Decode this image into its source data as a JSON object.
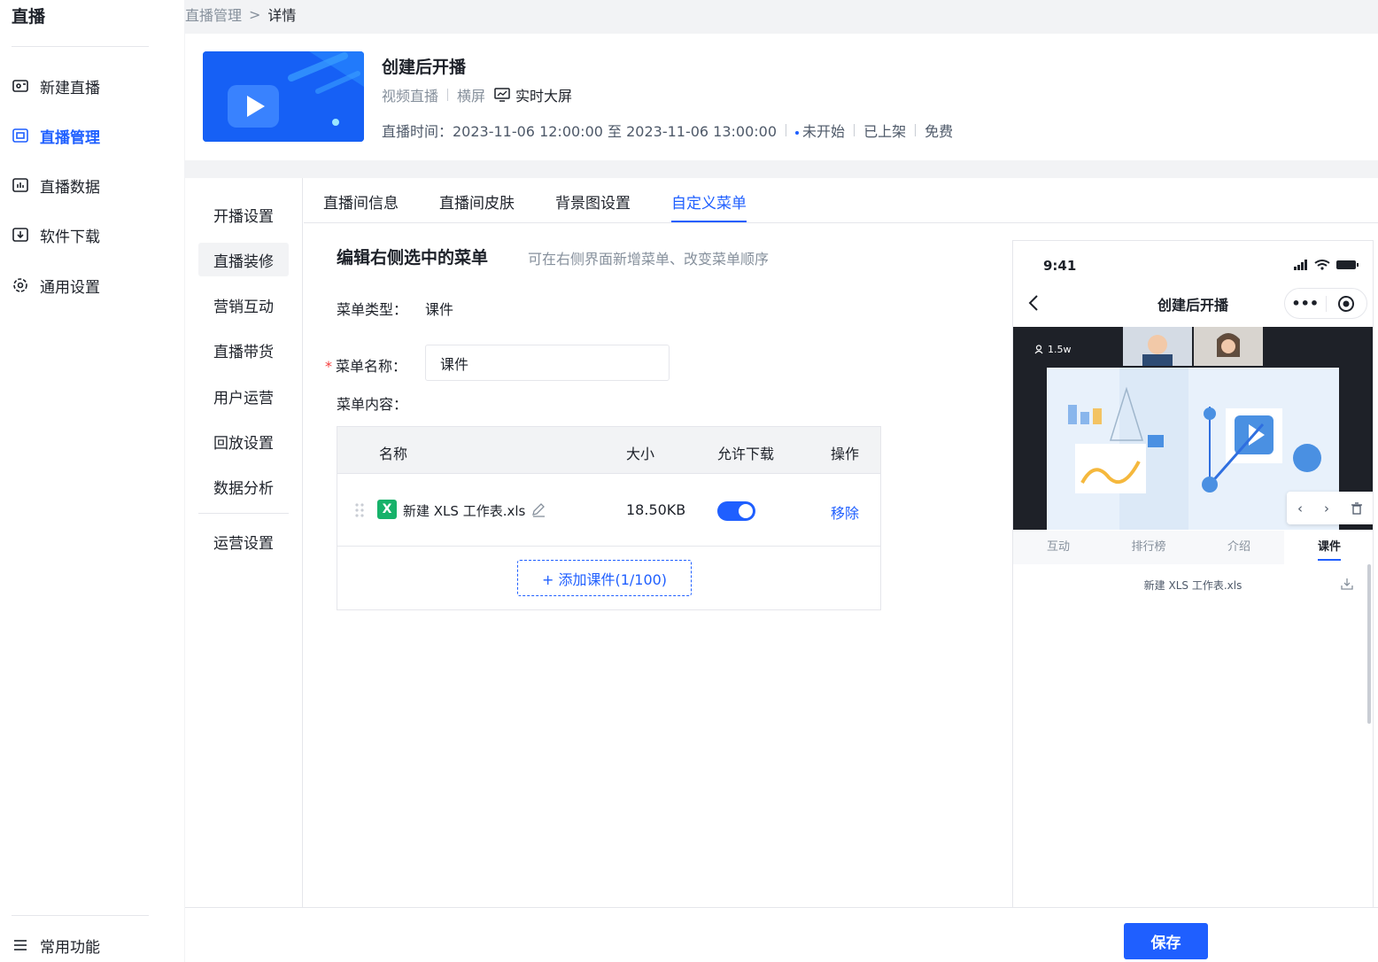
{
  "sidebar": {
    "title": "直播",
    "items": [
      {
        "label": "新建直播",
        "icon": "video-add-icon"
      },
      {
        "label": "直播管理",
        "icon": "live-manage-icon",
        "active": true
      },
      {
        "label": "直播数据",
        "icon": "data-chart-icon"
      },
      {
        "label": "软件下载",
        "icon": "download-icon"
      },
      {
        "label": "通用设置",
        "icon": "gear-icon"
      }
    ],
    "footer_label": "常用功能"
  },
  "breadcrumb": {
    "parent": "直播管理",
    "separator": ">",
    "current": "详情"
  },
  "live": {
    "title": "创建后开播",
    "type": "视频直播",
    "orientation": "横屏",
    "bigscreen": "实时大屏",
    "time_label": "直播时间：2023-11-06 12:00:00 至 2023-11-06 13:00:00",
    "status": "未开始",
    "shelf": "已上架",
    "price": "免费"
  },
  "subnav": [
    "开播设置",
    "直播装修",
    "营销互动",
    "直播带货",
    "用户运营",
    "回放设置",
    "数据分析",
    "运营设置"
  ],
  "tabs": [
    "直播间信息",
    "直播间皮肤",
    "背景图设置",
    "自定义菜单"
  ],
  "active_tab": "自定义菜单",
  "editor": {
    "title": "编辑右侧选中的菜单",
    "hint": "可在右侧界面新增菜单、改变菜单顺序",
    "type_label": "菜单类型：",
    "type_value": "课件",
    "name_label": "菜单名称：",
    "name_value": "课件",
    "content_label": "菜单内容："
  },
  "table": {
    "headers": {
      "name": "名称",
      "size": "大小",
      "download": "允许下载",
      "action": "操作"
    },
    "rows": [
      {
        "name": "新建 XLS 工作表.xls",
        "size": "18.50KB",
        "allow_download": true,
        "action": "移除"
      }
    ],
    "add_button": "+ 添加课件(1/100)"
  },
  "phone": {
    "time": "9:41",
    "title": "创建后开播",
    "more": "•••",
    "viewers": "1.5w",
    "tabs": [
      "互动",
      "排行榜",
      "介绍",
      "课件"
    ],
    "active_tab": "课件",
    "file": "新建 XLS 工作表.xls"
  },
  "save_button": "保存",
  "colors": {
    "primary": "#1f5fff",
    "required": "#f53f3f",
    "xls": "#17b26a"
  }
}
